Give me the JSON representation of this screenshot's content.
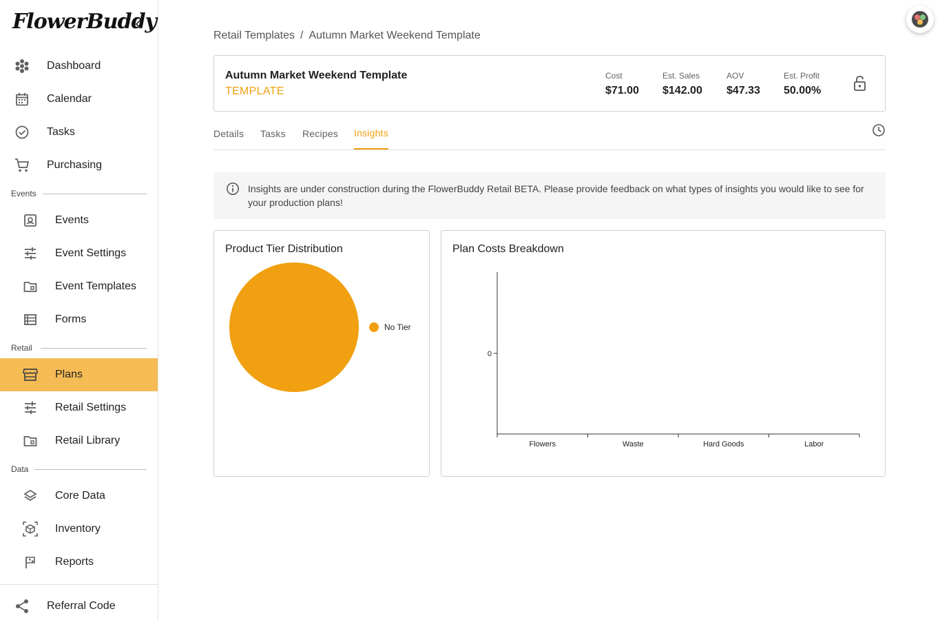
{
  "app": {
    "logo": "FlowerBuddy"
  },
  "sidebar": {
    "top_items": [
      {
        "label": "Dashboard",
        "icon": "flower-icon"
      },
      {
        "label": "Calendar",
        "icon": "calendar-icon"
      },
      {
        "label": "Tasks",
        "icon": "check-circle-icon"
      },
      {
        "label": "Purchasing",
        "icon": "cart-icon"
      }
    ],
    "sections": {
      "events": "Events",
      "retail": "Retail",
      "data": "Data"
    },
    "events_items": [
      {
        "label": "Events",
        "icon": "event-icon"
      },
      {
        "label": "Event Settings",
        "icon": "tune-icon"
      },
      {
        "label": "Event Templates",
        "icon": "folder-icon"
      },
      {
        "label": "Forms",
        "icon": "list-icon"
      }
    ],
    "retail_items": [
      {
        "label": "Plans",
        "icon": "storefront-icon",
        "active": true
      },
      {
        "label": "Retail Settings",
        "icon": "tune-icon"
      },
      {
        "label": "Retail Library",
        "icon": "folder-icon"
      }
    ],
    "data_items": [
      {
        "label": "Core Data",
        "icon": "layers-icon"
      },
      {
        "label": "Inventory",
        "icon": "box-icon"
      },
      {
        "label": "Reports",
        "icon": "flag-icon"
      }
    ],
    "referral": {
      "label": "Referral Code",
      "icon": "share-icon"
    }
  },
  "breadcrumb": {
    "parent": "Retail Templates",
    "separator": "/",
    "current": "Autumn Market Weekend Template"
  },
  "plan": {
    "title": "Autumn Market Weekend Template",
    "subtitle": "TEMPLATE",
    "stats": [
      {
        "label": "Cost",
        "value": "$71.00"
      },
      {
        "label": "Est. Sales",
        "value": "$142.00"
      },
      {
        "label": "AOV",
        "value": "$47.33"
      },
      {
        "label": "Est. Profit",
        "value": "50.00%"
      }
    ]
  },
  "tabs": [
    {
      "label": "Details"
    },
    {
      "label": "Tasks"
    },
    {
      "label": "Recipes"
    },
    {
      "label": "Insights",
      "active": true
    }
  ],
  "info_banner": {
    "text": "Insights are under construction during the FlowerBuddy Retail BETA. Please provide feedback on what types of insights you would like to see for your production plans!"
  },
  "colors": {
    "accent": "#f0a010",
    "active_nav": "#f5bc55",
    "pie_no_tier": "#f0a010"
  },
  "chart_data": [
    {
      "type": "pie",
      "title": "Product Tier Distribution",
      "slices": [
        {
          "label": "No Tier",
          "value": 1,
          "color": "#f0a010"
        }
      ],
      "legend": "right"
    },
    {
      "type": "bar",
      "title": "Plan Costs Breakdown",
      "categories": [
        "Flowers",
        "Waste",
        "Hard Goods",
        "Labor"
      ],
      "values": [
        0,
        0,
        0,
        0
      ],
      "y_ticks": [
        "0"
      ],
      "xlabel": "",
      "ylabel": "",
      "grid": false
    }
  ]
}
